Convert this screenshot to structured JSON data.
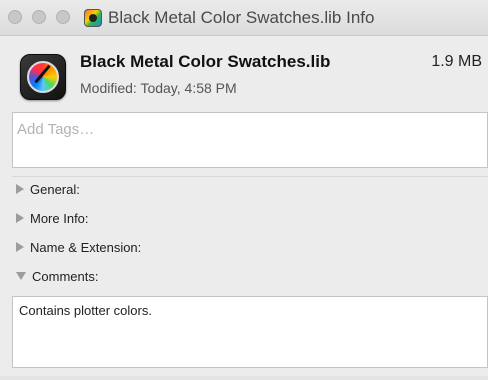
{
  "window": {
    "title": "Black Metal Color Swatches.lib Info"
  },
  "file": {
    "name": "Black Metal Color Swatches.lib",
    "size": "1.9 MB",
    "modified": "Modified: Today, 4:58 PM",
    "icon": "color-sync-utility-icon"
  },
  "tags": {
    "placeholder": "Add Tags…",
    "value": ""
  },
  "sections": {
    "general": "General:",
    "more_info": "More Info:",
    "name_extension": "Name & Extension:",
    "comments": "Comments:"
  },
  "comments": {
    "text": "Contains plotter colors."
  }
}
